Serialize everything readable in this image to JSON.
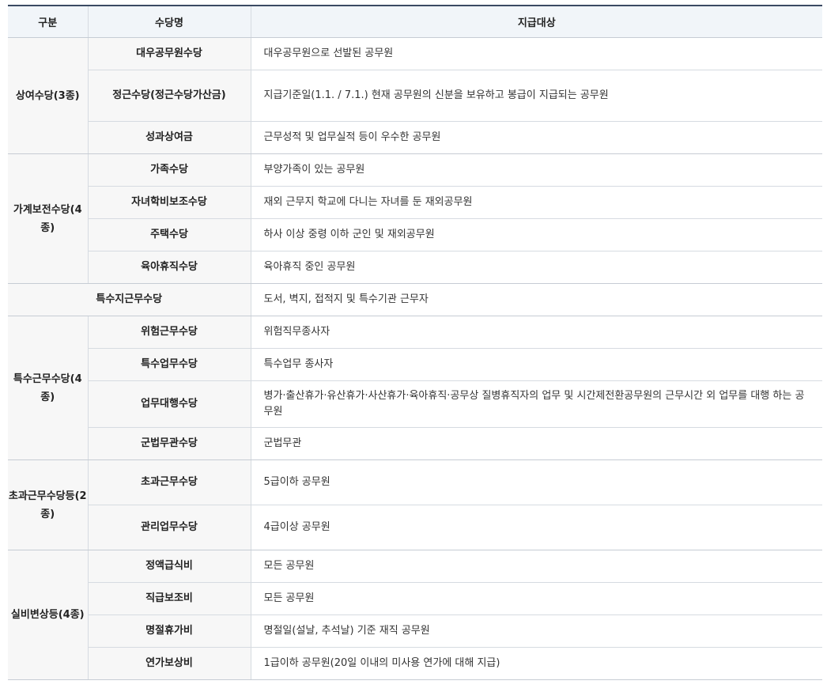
{
  "headers": [
    "구분",
    "수당명",
    "지급대상"
  ],
  "groups": [
    {
      "category": [
        "상여",
        "수당",
        "(3종)"
      ],
      "rows": [
        {
          "name": [
            "대우공무원수당"
          ],
          "target": "대우공무원으로 선발된 공무원"
        },
        {
          "name": [
            "정근수당",
            "(정근수당가산금)"
          ],
          "target": "지급기준일(1.1. / 7.1.) 현재 공무원의 신분을 보유하고 봉급이 지급되는 공무원"
        },
        {
          "name": [
            "성과상여금"
          ],
          "target": "근무성적 및 업무실적 등이 우수한 공무원"
        }
      ]
    },
    {
      "category": [
        "가계",
        "보전",
        "수당",
        "(4종)"
      ],
      "rows": [
        {
          "name": [
            "가족수당"
          ],
          "target": "부양가족이 있는 공무원"
        },
        {
          "name": [
            "자녀학비보조수당"
          ],
          "target": "재외 근무지 학교에 다니는 자녀를 둔 재외공무원"
        },
        {
          "name": [
            "주택수당"
          ],
          "target": "하사 이상 중령 이하 군인 및 재외공무원"
        },
        {
          "name": [
            "육아휴직수당"
          ],
          "target": "육아휴직 중인 공무원"
        }
      ]
    },
    {
      "merged_name": "특수지근무수당",
      "target": "도서, 벽지, 접적지 및 특수기관 근무자"
    },
    {
      "category": [
        "특수",
        "근무",
        "수당",
        "(4종)"
      ],
      "rows": [
        {
          "name": [
            "위험근무수당"
          ],
          "target": "위험직무종사자"
        },
        {
          "name": [
            "특수업무수당"
          ],
          "target": "특수업무 종사자"
        },
        {
          "name": [
            "업무대행수당"
          ],
          "target": "병가·출산휴가·유산휴가·사산휴가·육아휴직·공무상 질병휴직자의 업무 및 시간제전환공무원의 근무시간 외 업무를 대행 하는 공무원"
        },
        {
          "name": [
            "군법무관수당"
          ],
          "target": "군법무관"
        }
      ]
    },
    {
      "category": [
        "초과",
        "근무",
        "수당등",
        "(2종)"
      ],
      "rows": [
        {
          "name": [
            "초과근무수당"
          ],
          "target": "5급이하 공무원"
        },
        {
          "name": [
            "관리업무수당"
          ],
          "target": "4급이상 공무원"
        }
      ]
    },
    {
      "category": [
        "실비",
        "변상등",
        "(4종)"
      ],
      "rows": [
        {
          "name": [
            "정액급식비"
          ],
          "target": "모든 공무원"
        },
        {
          "name": [
            "직급보조비"
          ],
          "target": "모든 공무원"
        },
        {
          "name": [
            "명절휴가비"
          ],
          "target": "명절일(설날, 추석날) 기준 재직 공무원"
        },
        {
          "name": [
            "연가보상비"
          ],
          "target": "1급이하 공무원(20일 이내의 미사용 연가에 대해 지급)"
        }
      ]
    }
  ]
}
